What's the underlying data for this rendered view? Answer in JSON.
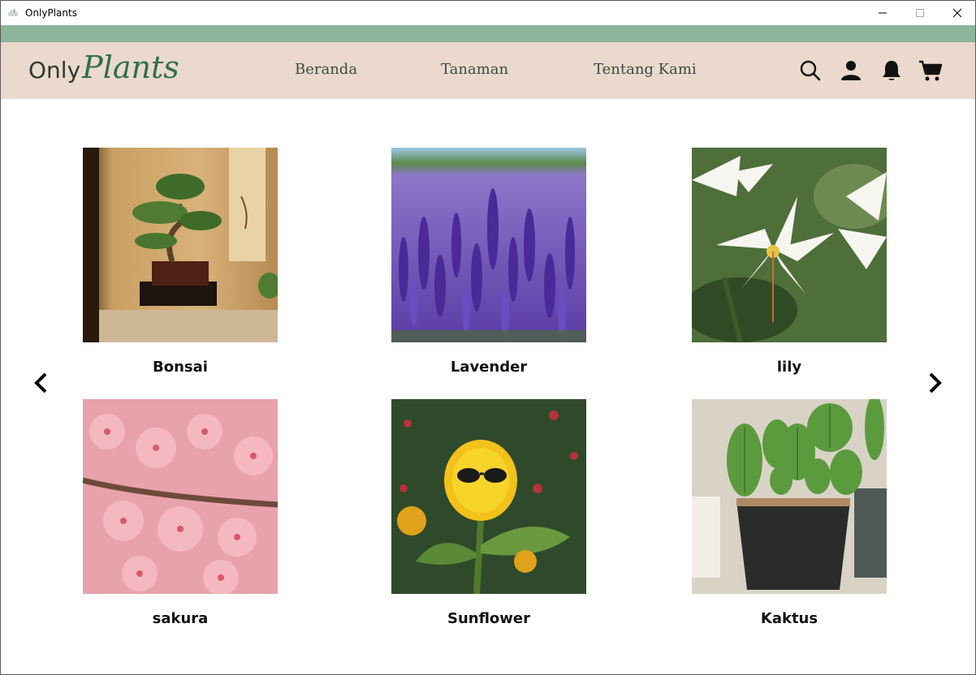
{
  "window": {
    "title": "OnlyPlants",
    "controls": {
      "minimize_icon": "minimize-icon",
      "maximize_icon": "maximize-icon",
      "close_icon": "close-icon"
    }
  },
  "colors": {
    "accent": "#8db59d",
    "nav_bg": "#ead9cc",
    "brand_green": "#2f6e48",
    "text_dark": "#3c4a43"
  },
  "logo": {
    "part1": "Only",
    "part2": "Plants"
  },
  "nav": {
    "links": [
      "Beranda",
      "Tanaman",
      "Tentang Kami"
    ],
    "icons": [
      "search-icon",
      "user-icon",
      "bell-icon",
      "cart-icon"
    ]
  },
  "carousel": {
    "prev_icon": "chevron-left-icon",
    "next_icon": "chevron-right-icon",
    "plants": [
      {
        "name": "Bonsai"
      },
      {
        "name": "Lavender"
      },
      {
        "name": "lily"
      },
      {
        "name": "sakura"
      },
      {
        "name": "Sunflower"
      },
      {
        "name": "Kaktus"
      }
    ]
  }
}
